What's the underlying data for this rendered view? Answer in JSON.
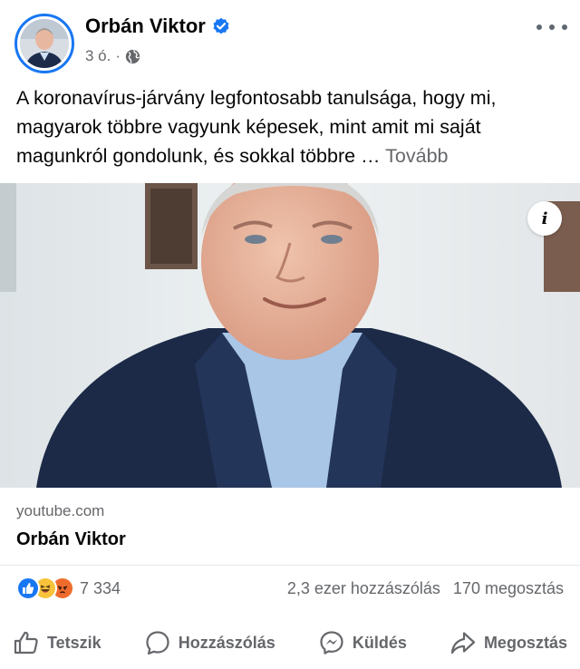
{
  "post": {
    "author": "Orbán Viktor",
    "time": "3 ó.",
    "separator": "·",
    "text": "A koronavírus-járvány legfontosabb tanulsága, hogy mi, magyarok többre vagyunk képesek, mint amit mi saját magunkról gondolunk, és sokkal többre … ",
    "more_label": "Tovább"
  },
  "link_preview": {
    "domain": "youtube.com",
    "title": "Orbán Viktor"
  },
  "stats": {
    "reaction_count": "7 334",
    "comments": "2,3 ezer hozzászólás",
    "shares": "170 megosztás"
  },
  "actions": {
    "like": "Tetszik",
    "comment": "Hozzászólás",
    "send": "Küldés",
    "share": "Megosztás"
  },
  "icons": {
    "verified": "verified-badge-icon",
    "audience": "globe-icon",
    "more": "more-options-icon",
    "info": "info-icon",
    "reactions": [
      "like-reaction-icon",
      "haha-reaction-icon",
      "angry-reaction-icon"
    ]
  },
  "colors": {
    "brand_blue": "#1877f2",
    "secondary_text": "#65676b",
    "primary_text": "#050505"
  }
}
